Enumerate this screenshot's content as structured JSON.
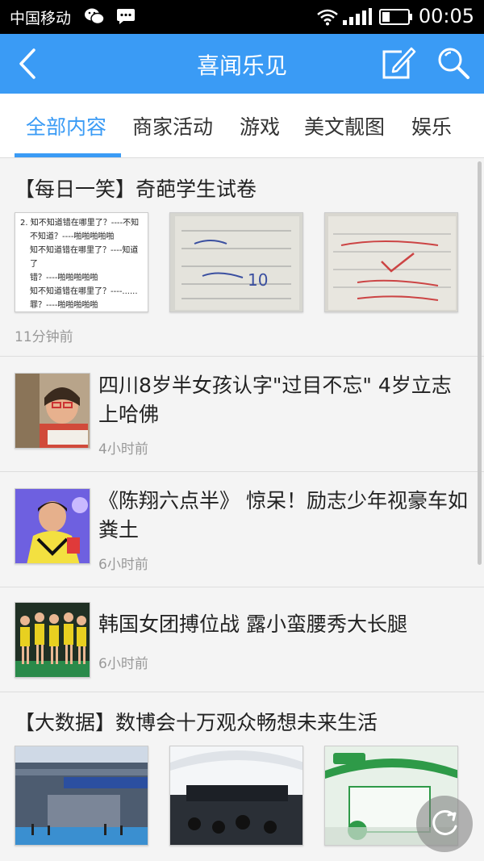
{
  "status_bar": {
    "carrier": "中国移动",
    "time": "00:05",
    "icons": [
      "wechat-icon",
      "message-icon",
      "wifi-icon",
      "signal-icon",
      "battery-icon"
    ]
  },
  "app_bar": {
    "title": "喜闻乐见",
    "icons": [
      "back-arrow-icon",
      "edit-icon",
      "search-icon"
    ]
  },
  "tabs": [
    {
      "label": "全部内容",
      "active": true
    },
    {
      "label": "商家活动",
      "active": false
    },
    {
      "label": "游戏",
      "active": false
    },
    {
      "label": "美文靓图",
      "active": false
    },
    {
      "label": "娱乐",
      "active": false
    }
  ],
  "feed": {
    "items": [
      {
        "layout": "three-images",
        "title": "【每日一笑】奇葩学生试卷",
        "time": "11分钟前",
        "image1_lines": [
          "2. 知不知道错在哪里了？----不知",
          "不知道？----啪啪啪啪啪",
          "知不知道错在哪里了？----知道了",
          "错？----啪啪啪啪啪",
          "知不知道错在哪里了？----......",
          "罪？----啪啪啪啪啪"
        ]
      },
      {
        "layout": "single-image",
        "title": "四川8岁半女孩认字\"过目不忘\" 4岁立志上哈佛",
        "time": "4小时前"
      },
      {
        "layout": "single-image",
        "title": "《陈翔六点半》 惊呆！励志少年视豪车如粪土",
        "time": "6小时前"
      },
      {
        "layout": "single-image",
        "title": "韩国女团搏位战 露小蛮腰秀大长腿",
        "time": "6小时前"
      },
      {
        "layout": "three-images",
        "title": "【大数据】数博会十万观众畅想未来生活",
        "time": ""
      }
    ]
  },
  "colors": {
    "accent": "#3a9bf5",
    "status_bar": "#000000",
    "time_text": "#999999"
  }
}
